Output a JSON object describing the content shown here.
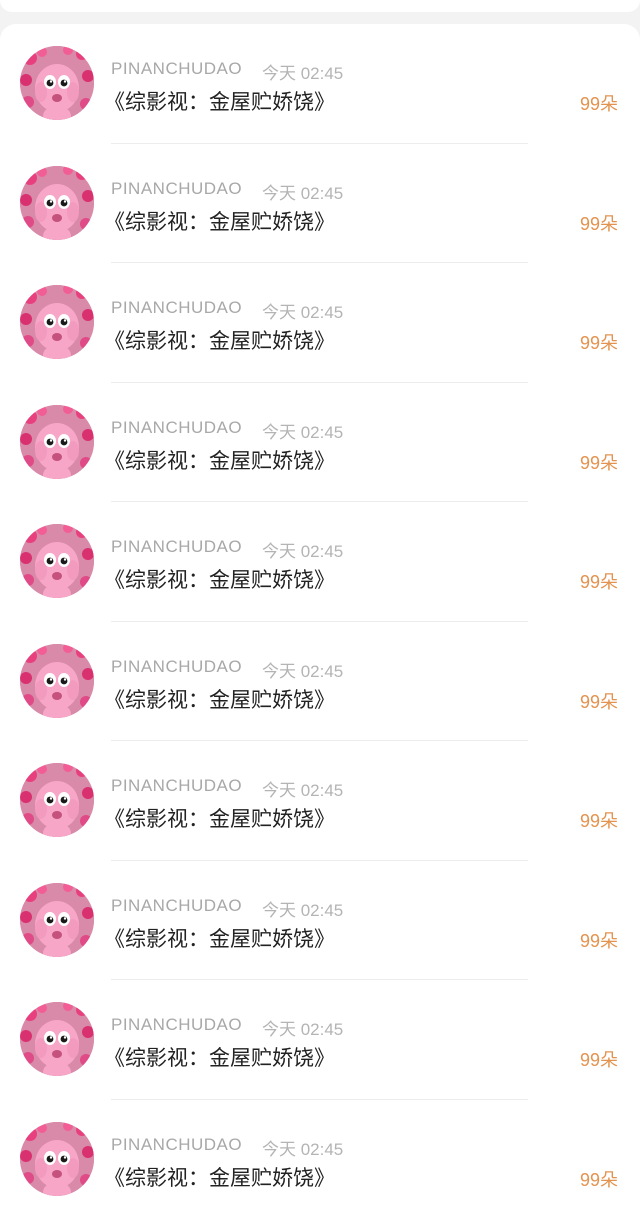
{
  "colors": {
    "amount": "#e3934f",
    "username": "#a8a8a8",
    "title": "#222222"
  },
  "rows": [
    {
      "avatar_icon": "pony-avatar-icon",
      "user": "PINANCHUDAO",
      "time": "今天 02:45",
      "title": "《综影视：金屋贮娇饶》",
      "amount": "99朵"
    },
    {
      "avatar_icon": "pony-avatar-icon",
      "user": "PINANCHUDAO",
      "time": "今天 02:45",
      "title": "《综影视：金屋贮娇饶》",
      "amount": "99朵"
    },
    {
      "avatar_icon": "pony-avatar-icon",
      "user": "PINANCHUDAO",
      "time": "今天 02:45",
      "title": "《综影视：金屋贮娇饶》",
      "amount": "99朵"
    },
    {
      "avatar_icon": "pony-avatar-icon",
      "user": "PINANCHUDAO",
      "time": "今天 02:45",
      "title": "《综影视：金屋贮娇饶》",
      "amount": "99朵"
    },
    {
      "avatar_icon": "pony-avatar-icon",
      "user": "PINANCHUDAO",
      "time": "今天 02:45",
      "title": "《综影视：金屋贮娇饶》",
      "amount": "99朵"
    },
    {
      "avatar_icon": "pony-avatar-icon",
      "user": "PINANCHUDAO",
      "time": "今天 02:45",
      "title": "《综影视：金屋贮娇饶》",
      "amount": "99朵"
    },
    {
      "avatar_icon": "pony-avatar-icon",
      "user": "PINANCHUDAO",
      "time": "今天 02:45",
      "title": "《综影视：金屋贮娇饶》",
      "amount": "99朵"
    },
    {
      "avatar_icon": "pony-avatar-icon",
      "user": "PINANCHUDAO",
      "time": "今天 02:45",
      "title": "《综影视：金屋贮娇饶》",
      "amount": "99朵"
    },
    {
      "avatar_icon": "pony-avatar-icon",
      "user": "PINANCHUDAO",
      "time": "今天 02:45",
      "title": "《综影视：金屋贮娇饶》",
      "amount": "99朵"
    },
    {
      "avatar_icon": "pony-avatar-icon",
      "user": "PINANCHUDAO",
      "time": "今天 02:45",
      "title": "《综影视：金屋贮娇饶》",
      "amount": "99朵"
    }
  ]
}
